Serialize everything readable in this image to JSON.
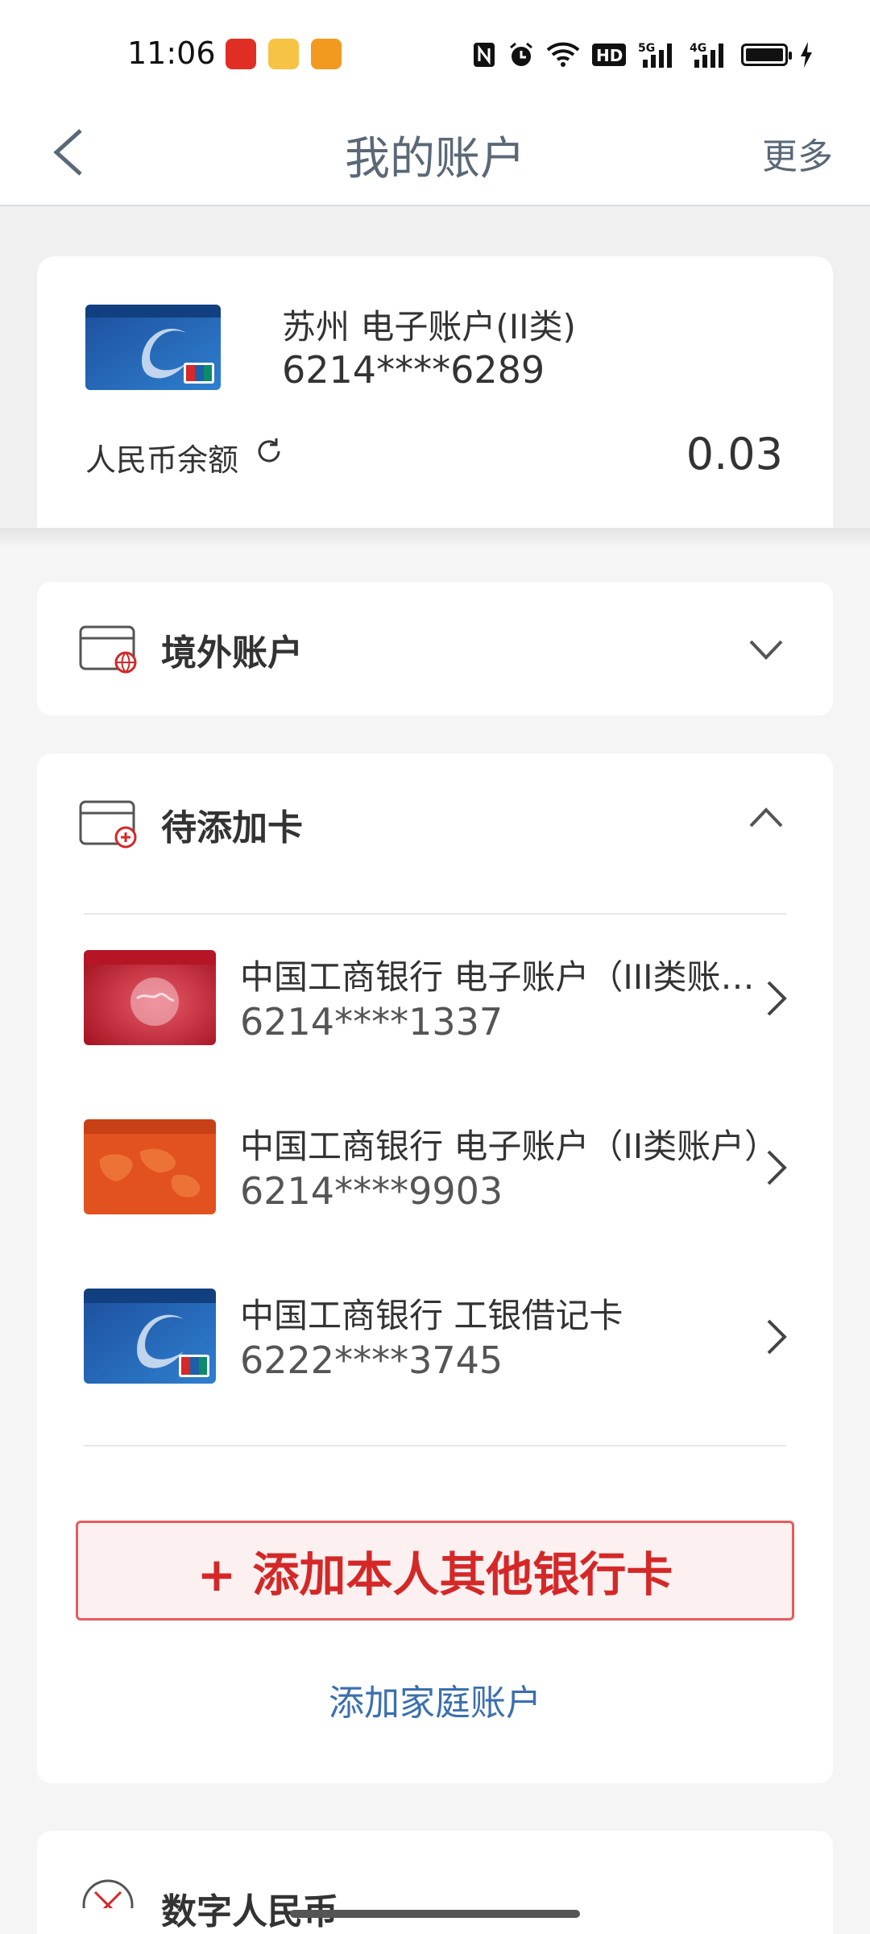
{
  "status_bar": {
    "time": "11:06",
    "apps": [
      "pinduoduo-icon",
      "xianyu-icon",
      "gongyinapp-icon"
    ],
    "network_badge": "HD",
    "signal_5g": "5G",
    "signal_4g": "4G"
  },
  "nav": {
    "title": "我的账户",
    "more": "更多"
  },
  "main_card": {
    "name": "苏州 电子账户(II类)",
    "number": "6214****6289",
    "balance_label": "人民币余额",
    "balance": "0.03"
  },
  "overseas": {
    "title": "境外账户"
  },
  "pending": {
    "title": "待添加卡",
    "cards": [
      {
        "bank": "中国工商银行  电子账户（III类账户）",
        "number": "6214****1337",
        "style": "red-globe"
      },
      {
        "bank": "中国工商银行  电子账户（II类账户）",
        "number": "6214****9903",
        "style": "orange-map"
      },
      {
        "bank": "中国工商银行  工银借记卡",
        "number": "6222****3745",
        "style": "blue-e"
      }
    ],
    "add_button": "+ 添加本人其他银行卡",
    "family_link": "添加家庭账户"
  },
  "bottom_peek": {
    "title": "数字人民币"
  },
  "colors": {
    "accent_red": "#d42828",
    "link_blue": "#3b6fb0",
    "title_gray": "#5a6877"
  }
}
